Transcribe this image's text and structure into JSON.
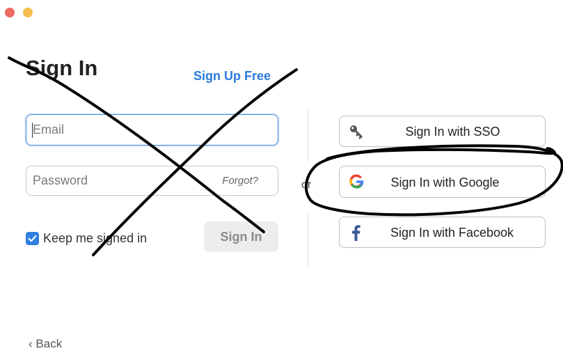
{
  "window": {
    "controls": [
      "close",
      "minimize"
    ]
  },
  "signin": {
    "title": "Sign In",
    "signup_link": "Sign Up Free",
    "email_placeholder": "Email",
    "password_placeholder": "Password",
    "forgot_link": "Forgot?",
    "keep_signed_in_label": "Keep me signed in",
    "keep_signed_in_checked": true,
    "signin_button": "Sign In"
  },
  "divider_text": "or",
  "sso": {
    "buttons": [
      {
        "label": "Sign In with SSO",
        "icon": "key-icon"
      },
      {
        "label": "Sign In with Google",
        "icon": "google-icon"
      },
      {
        "label": "Sign In with Facebook",
        "icon": "facebook-icon"
      }
    ]
  },
  "footer": {
    "back_label": "Back"
  },
  "colors": {
    "accent": "#2b7bdc",
    "checkbox": "#2f7fe0",
    "close": "#ee6a5f",
    "minimize": "#f5be4f",
    "annotation": "#000000"
  },
  "annotations": [
    "x-cross-over-email-form",
    "circle-around-google-button"
  ]
}
